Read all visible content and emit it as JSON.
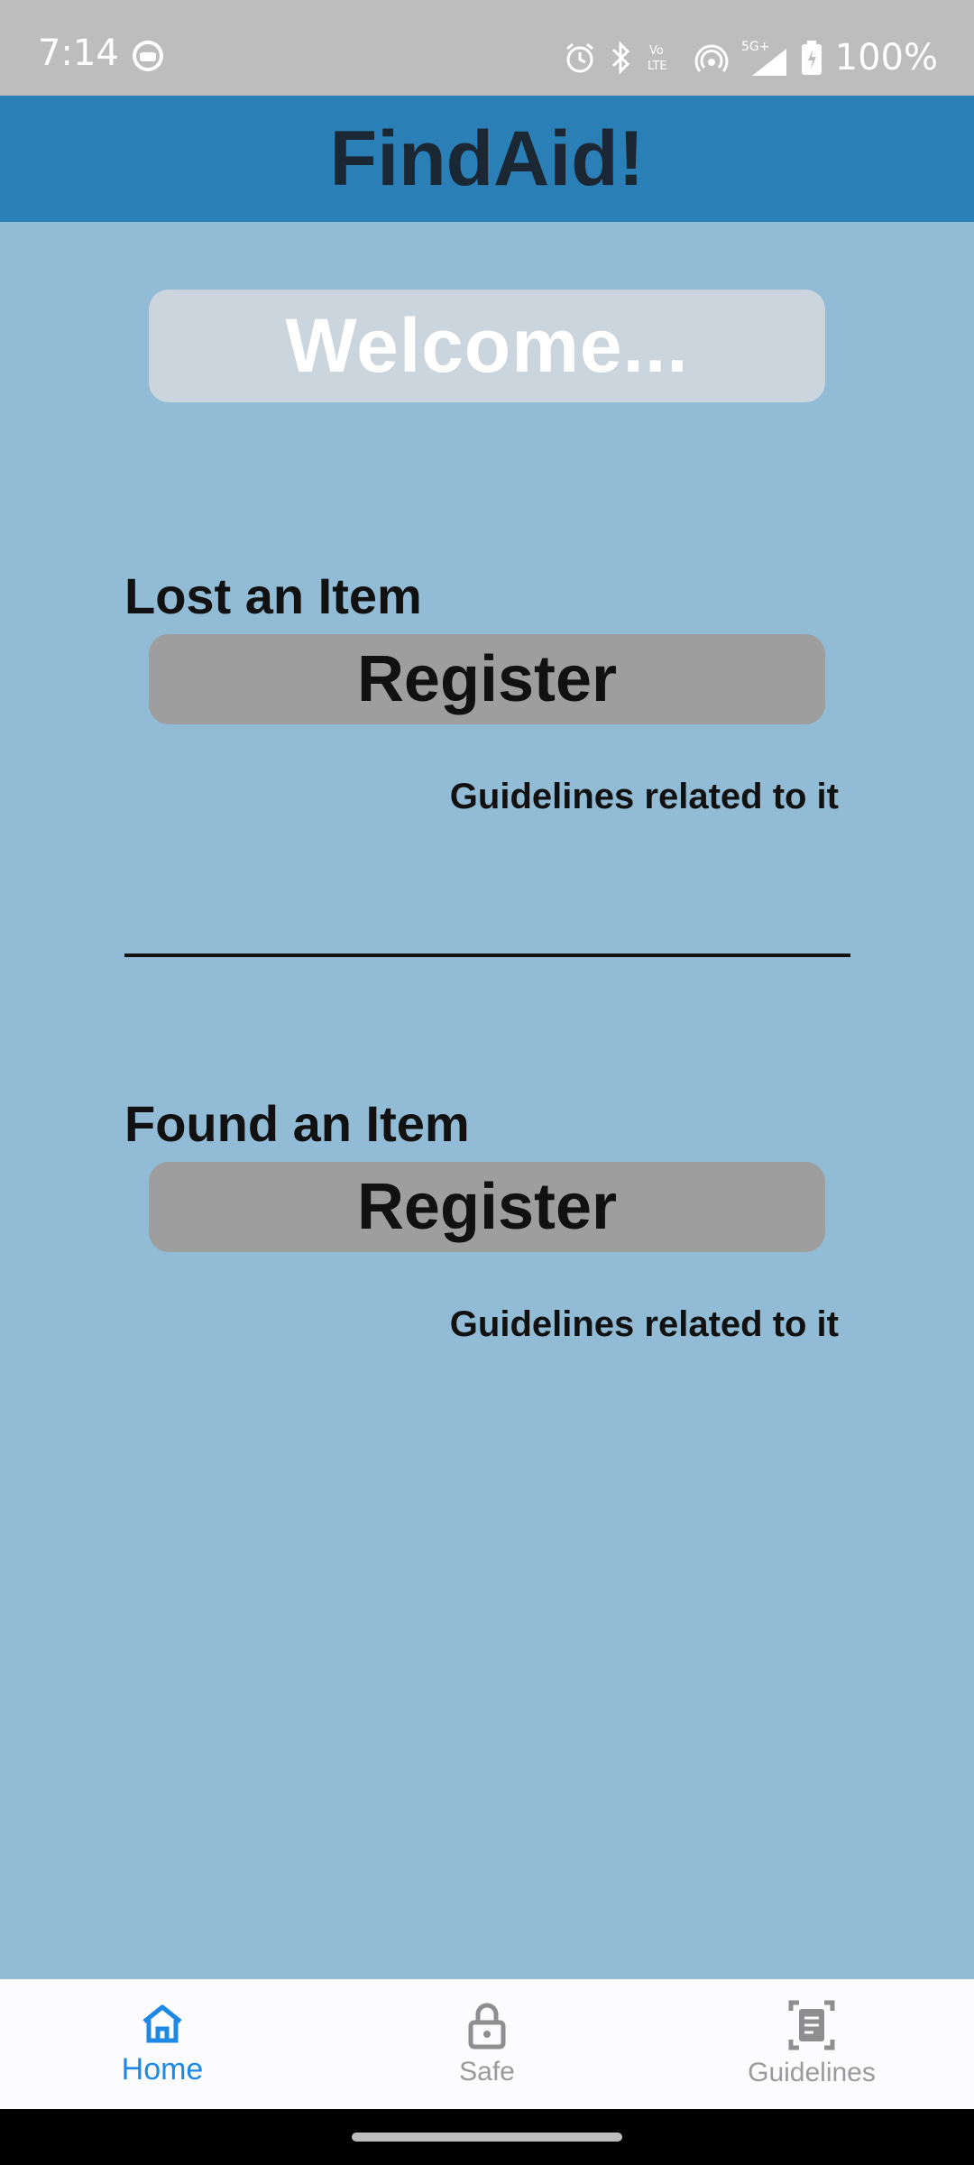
{
  "status_bar": {
    "time": "7:14",
    "battery": "100%",
    "icons": [
      "app-notification-icon",
      "alarm-icon",
      "bluetooth-icon",
      "volte-icon",
      "hotspot-icon",
      "signal-5g-icon",
      "battery-icon"
    ]
  },
  "app_bar": {
    "title": "FindAid!"
  },
  "welcome": {
    "text": "Welcome..."
  },
  "lost": {
    "heading": "Lost an Item",
    "button": "Register",
    "guidelines": "Guidelines related to it"
  },
  "found": {
    "heading": "Found an Item",
    "button": "Register",
    "guidelines": "Guidelines related to it"
  },
  "bottom_nav": {
    "items": [
      {
        "label": "Home",
        "icon": "home-icon",
        "active": true
      },
      {
        "label": "Safe",
        "icon": "lock-icon",
        "active": false
      },
      {
        "label": "Guidelines",
        "icon": "document-icon",
        "active": false
      }
    ]
  },
  "colors": {
    "background": "#92bcd6",
    "app_bar": "#2a7fb6",
    "button": "#9e9e9e",
    "nav_active": "#1e88e5"
  }
}
